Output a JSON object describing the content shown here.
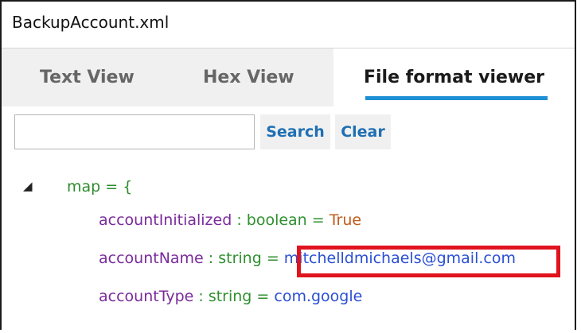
{
  "window": {
    "title": "BackupAccount.xml"
  },
  "tabs": [
    {
      "label": "Text View",
      "active": false
    },
    {
      "label": "Hex View",
      "active": false
    },
    {
      "label": "File format viewer",
      "active": true
    }
  ],
  "toolbar": {
    "search_value": "",
    "search_button": "Search",
    "clear_button": "Clear"
  },
  "tree": {
    "root": {
      "expander_icon": "triangle-down-icon",
      "text": "map = {"
    },
    "items": [
      {
        "name": "accountInitialized",
        "sep": " : ",
        "type": "boolean",
        "eq": " = ",
        "value": "True"
      },
      {
        "name": "accountName",
        "sep": " : ",
        "type": "string",
        "eq": " = ",
        "value": "mitchelldmichaels@gmail.com"
      },
      {
        "name": "accountType",
        "sep": " : ",
        "type": "string",
        "eq": " = ",
        "value": "com.google"
      }
    ]
  },
  "annotation": {
    "color": "#e0141e",
    "target": "accountName value"
  },
  "colors": {
    "accent": "#1e90d6",
    "button_text": "#1f6fb3",
    "property": "#7a2b9b",
    "type": "#2f8f2f",
    "string_value": "#2a4fd4",
    "bool_value": "#c05a1a"
  }
}
